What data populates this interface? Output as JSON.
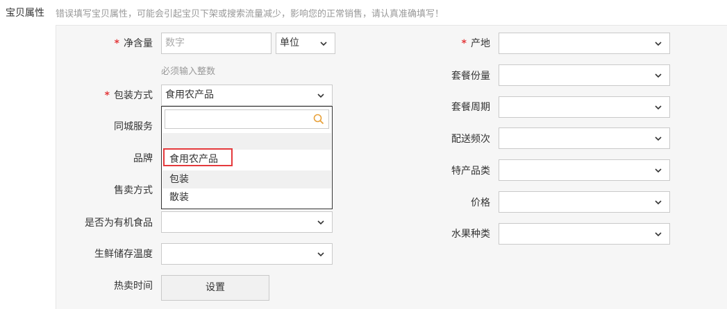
{
  "header": {
    "title": "宝贝属性",
    "warning": "错误填写宝贝属性，可能会引起宝贝下架或搜索流量减少，影响您的正常销售，请认真准确填写！"
  },
  "left": {
    "net_content": {
      "label": "净含量",
      "placeholder": "数字",
      "unit": "单位",
      "hint": "必须输入整数"
    },
    "packaging": {
      "label": "包装方式",
      "value": "食用农产品"
    },
    "city_service": {
      "label": "同城服务"
    },
    "brand": {
      "label": "品牌"
    },
    "sale_method": {
      "label": "售卖方式"
    },
    "organic": {
      "label": "是否为有机食品"
    },
    "storage_temp": {
      "label": "生鲜储存温度"
    },
    "hot_time": {
      "label": "热卖时间",
      "button": "设置"
    }
  },
  "right": {
    "origin": {
      "label": "产地"
    },
    "package_qty": {
      "label": "套餐份量"
    },
    "package_cycle": {
      "label": "套餐周期"
    },
    "delivery_freq": {
      "label": "配送频次"
    },
    "specialty": {
      "label": "特产品类"
    },
    "price": {
      "label": "价格"
    },
    "fruit_type": {
      "label": "水果种类"
    }
  },
  "dropdown": {
    "options": [
      "食用农产品",
      "包装",
      "散装"
    ]
  },
  "colors": {
    "required": "#e4393c",
    "search_icon": "#e8a13a"
  }
}
